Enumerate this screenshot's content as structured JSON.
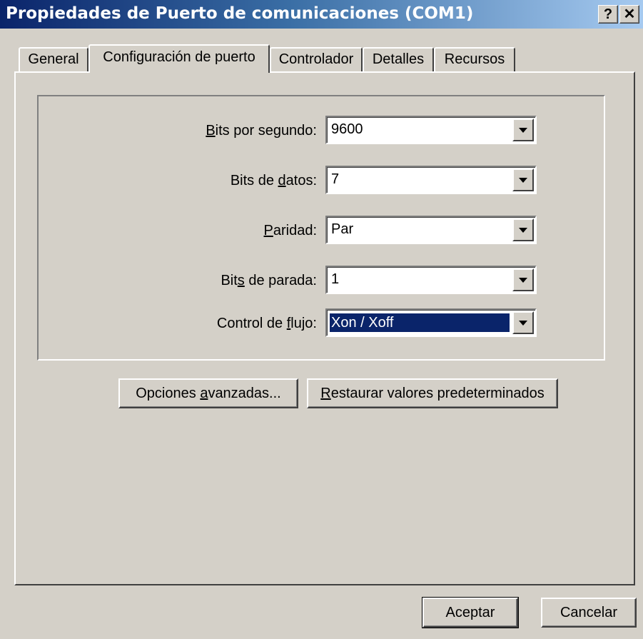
{
  "window": {
    "title": "Propiedades de Puerto de comunicaciones (COM1)",
    "help_button": "?",
    "close_button": "✕"
  },
  "tabs": [
    {
      "label": "General",
      "active": false
    },
    {
      "label": "Configuración de puerto",
      "active": true
    },
    {
      "label": "Controlador",
      "active": false
    },
    {
      "label": "Detalles",
      "active": false
    },
    {
      "label": "Recursos",
      "active": false
    }
  ],
  "settings": {
    "bits_per_second": {
      "label_pre": "",
      "label_key": "B",
      "label_post": "its por segundo:",
      "value": "9600"
    },
    "data_bits": {
      "label_pre": "Bits de ",
      "label_key": "d",
      "label_post": "atos:",
      "value": "7"
    },
    "parity": {
      "label_pre": "",
      "label_key": "P",
      "label_post": "aridad:",
      "value": "Par"
    },
    "stop_bits": {
      "label_pre": "Bit",
      "label_key": "s",
      "label_post": " de parada:",
      "value": "1"
    },
    "flow_control": {
      "label_pre": "Control de ",
      "label_key": "f",
      "label_post": "lujo:",
      "value": "Xon / Xoff"
    }
  },
  "buttons": {
    "advanced": {
      "pre": "Opciones ",
      "key": "a",
      "post": "vanzadas..."
    },
    "restore": {
      "pre": "",
      "key": "R",
      "post": "estaurar valores predeterminados"
    },
    "ok": "Aceptar",
    "cancel": "Cancelar"
  },
  "colors": {
    "face": "#d4d0c8",
    "title_start": "#0a246a",
    "title_end": "#a6caf0",
    "selection": "#0a246a"
  }
}
